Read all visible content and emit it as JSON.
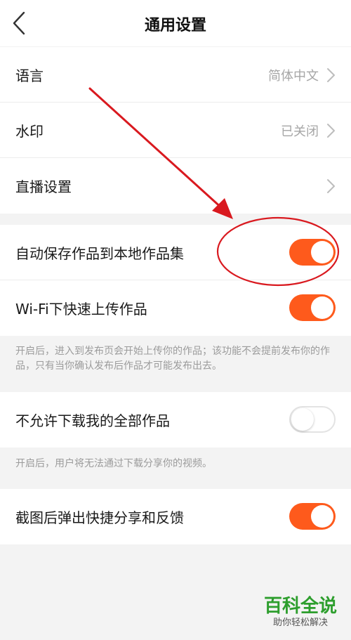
{
  "header": {
    "title": "通用设置"
  },
  "section1": {
    "items": [
      {
        "label": "语言",
        "value": "简体中文"
      },
      {
        "label": "水印",
        "value": "已关闭"
      },
      {
        "label": "直播设置",
        "value": ""
      }
    ]
  },
  "section2": {
    "items": [
      {
        "label": "自动保存作品到本地作品集",
        "toggle": "on"
      },
      {
        "label": "Wi-Fi下快速上传作品",
        "toggle": "on"
      }
    ],
    "note": "开启后，进入到发布页会开始上传你的作品；该功能不会提前发布你的作品，只有当你确认发布后作品才可能发布出去。"
  },
  "section3": {
    "items": [
      {
        "label": "不允许下载我的全部作品",
        "toggle": "off"
      }
    ],
    "note": "开启后，用户将无法通过下载分享你的视频。"
  },
  "section4": {
    "items": [
      {
        "label": "截图后弹出快捷分享和反馈",
        "toggle": "on"
      }
    ]
  },
  "watermark": {
    "main": "百科全说",
    "sub": "助你轻松解决"
  },
  "colors": {
    "toggle_on": "#fe5a1c",
    "annotation": "#d9191f"
  }
}
